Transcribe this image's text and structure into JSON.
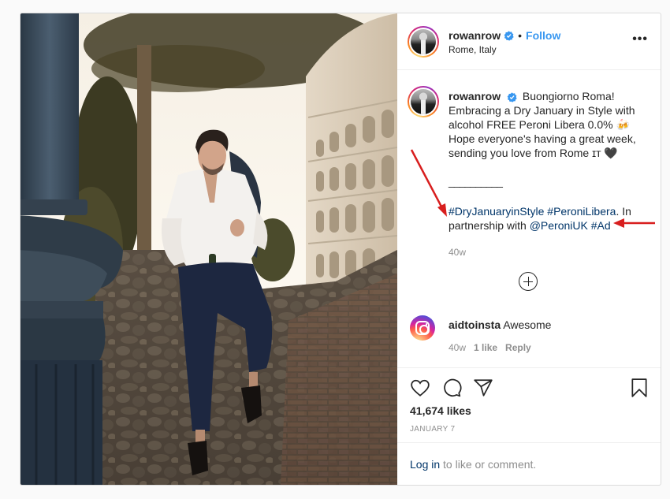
{
  "post": {
    "author": {
      "username": "rowanrow",
      "verified": true,
      "location": "Rome, Italy",
      "follow_label": "Follow",
      "separator": "•"
    },
    "more_icon": "more-horizontal-icon",
    "more_label": "•••",
    "caption": {
      "line1": "Buongiorno Roma! Embracing a Dry January in Style with alcohol FREE Peroni Libera 0.0% ",
      "emoji": "🍻",
      "line2": " Hope everyone's having a great week, sending you love from Rome ",
      "flag": "ɪᴛ",
      "heart": "🖤",
      "rule": "__________",
      "hashtag1": "#DryJanuaryinStyle",
      "hashtag2": "#PeroniLibera",
      "mid_text": ". In partnership with ",
      "mention": "@PeroniUK",
      "hashtag3": "#Ad",
      "time": "40w"
    },
    "load_more_icon": "plus-circle-icon",
    "comments": [
      {
        "username": "aidtoinsta",
        "text": "Awesome",
        "time": "40w",
        "likes": "1 like",
        "reply_label": "Reply"
      }
    ],
    "actions": {
      "like_icon": "heart-icon",
      "comment_icon": "comment-icon",
      "share_icon": "share-icon",
      "save_icon": "bookmark-icon"
    },
    "likes": "41,674 likes",
    "date": "JANUARY 7",
    "login": {
      "link_label": "Log in",
      "rest": " to like or comment."
    },
    "image_alt": "Man in white shirt sitting on ancient stone wall near the Colosseum in Rome holding a Peroni bottle",
    "annotation_color": "#d81e1e"
  }
}
